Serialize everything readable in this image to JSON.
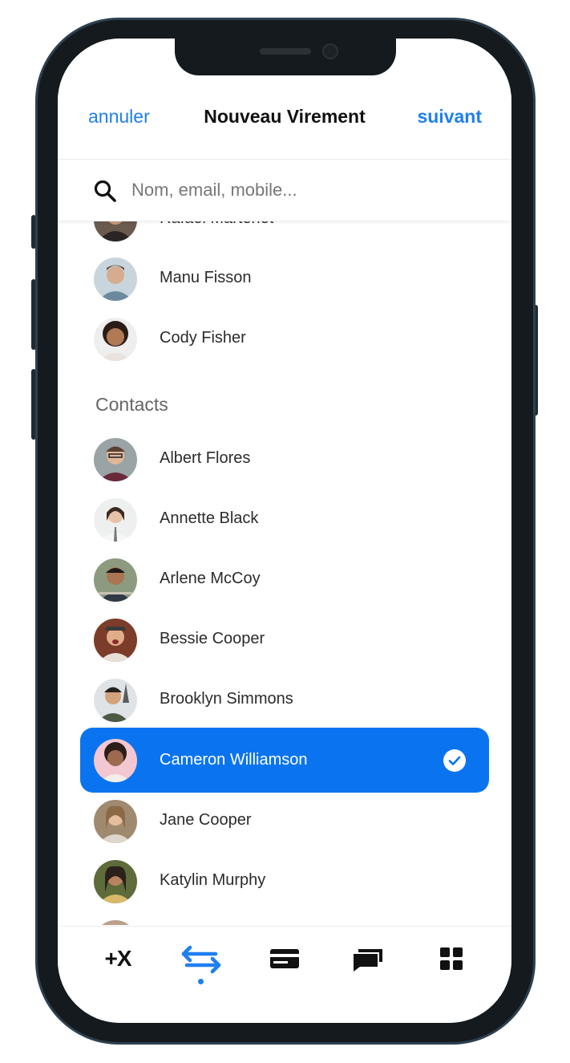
{
  "header": {
    "cancel_label": "annuler",
    "title": "Nouveau Virement",
    "next_label": "suivant"
  },
  "search": {
    "placeholder": "Nom, email, mobile...",
    "value": ""
  },
  "recent": [
    {
      "name": "Rafael Martenet",
      "partially_hidden": true
    },
    {
      "name": "Manu Fisson"
    },
    {
      "name": "Cody Fisher"
    }
  ],
  "contacts": {
    "section_title": "Contacts",
    "items": [
      {
        "name": "Albert Flores",
        "selected": false
      },
      {
        "name": "Annette Black",
        "selected": false
      },
      {
        "name": "Arlene McCoy",
        "selected": false
      },
      {
        "name": "Bessie Cooper",
        "selected": false
      },
      {
        "name": "Brooklyn Simmons",
        "selected": false
      },
      {
        "name": "Cameron Williamson",
        "selected": true
      },
      {
        "name": "Jane Cooper",
        "selected": false
      },
      {
        "name": "Katylin Murphy",
        "selected": false
      }
    ]
  },
  "tabbar": {
    "tabs": [
      {
        "label": "+X",
        "icon": "plus-x-icon",
        "active": false
      },
      {
        "icon": "transfer-arrows-icon",
        "active": true
      },
      {
        "icon": "card-icon",
        "active": false
      },
      {
        "icon": "chat-icon",
        "active": false
      },
      {
        "icon": "grid-icon",
        "active": false
      }
    ]
  },
  "colors": {
    "accent": "#1f7ff0",
    "selected_row": "#0a74f0",
    "frame": "#141a1d"
  }
}
